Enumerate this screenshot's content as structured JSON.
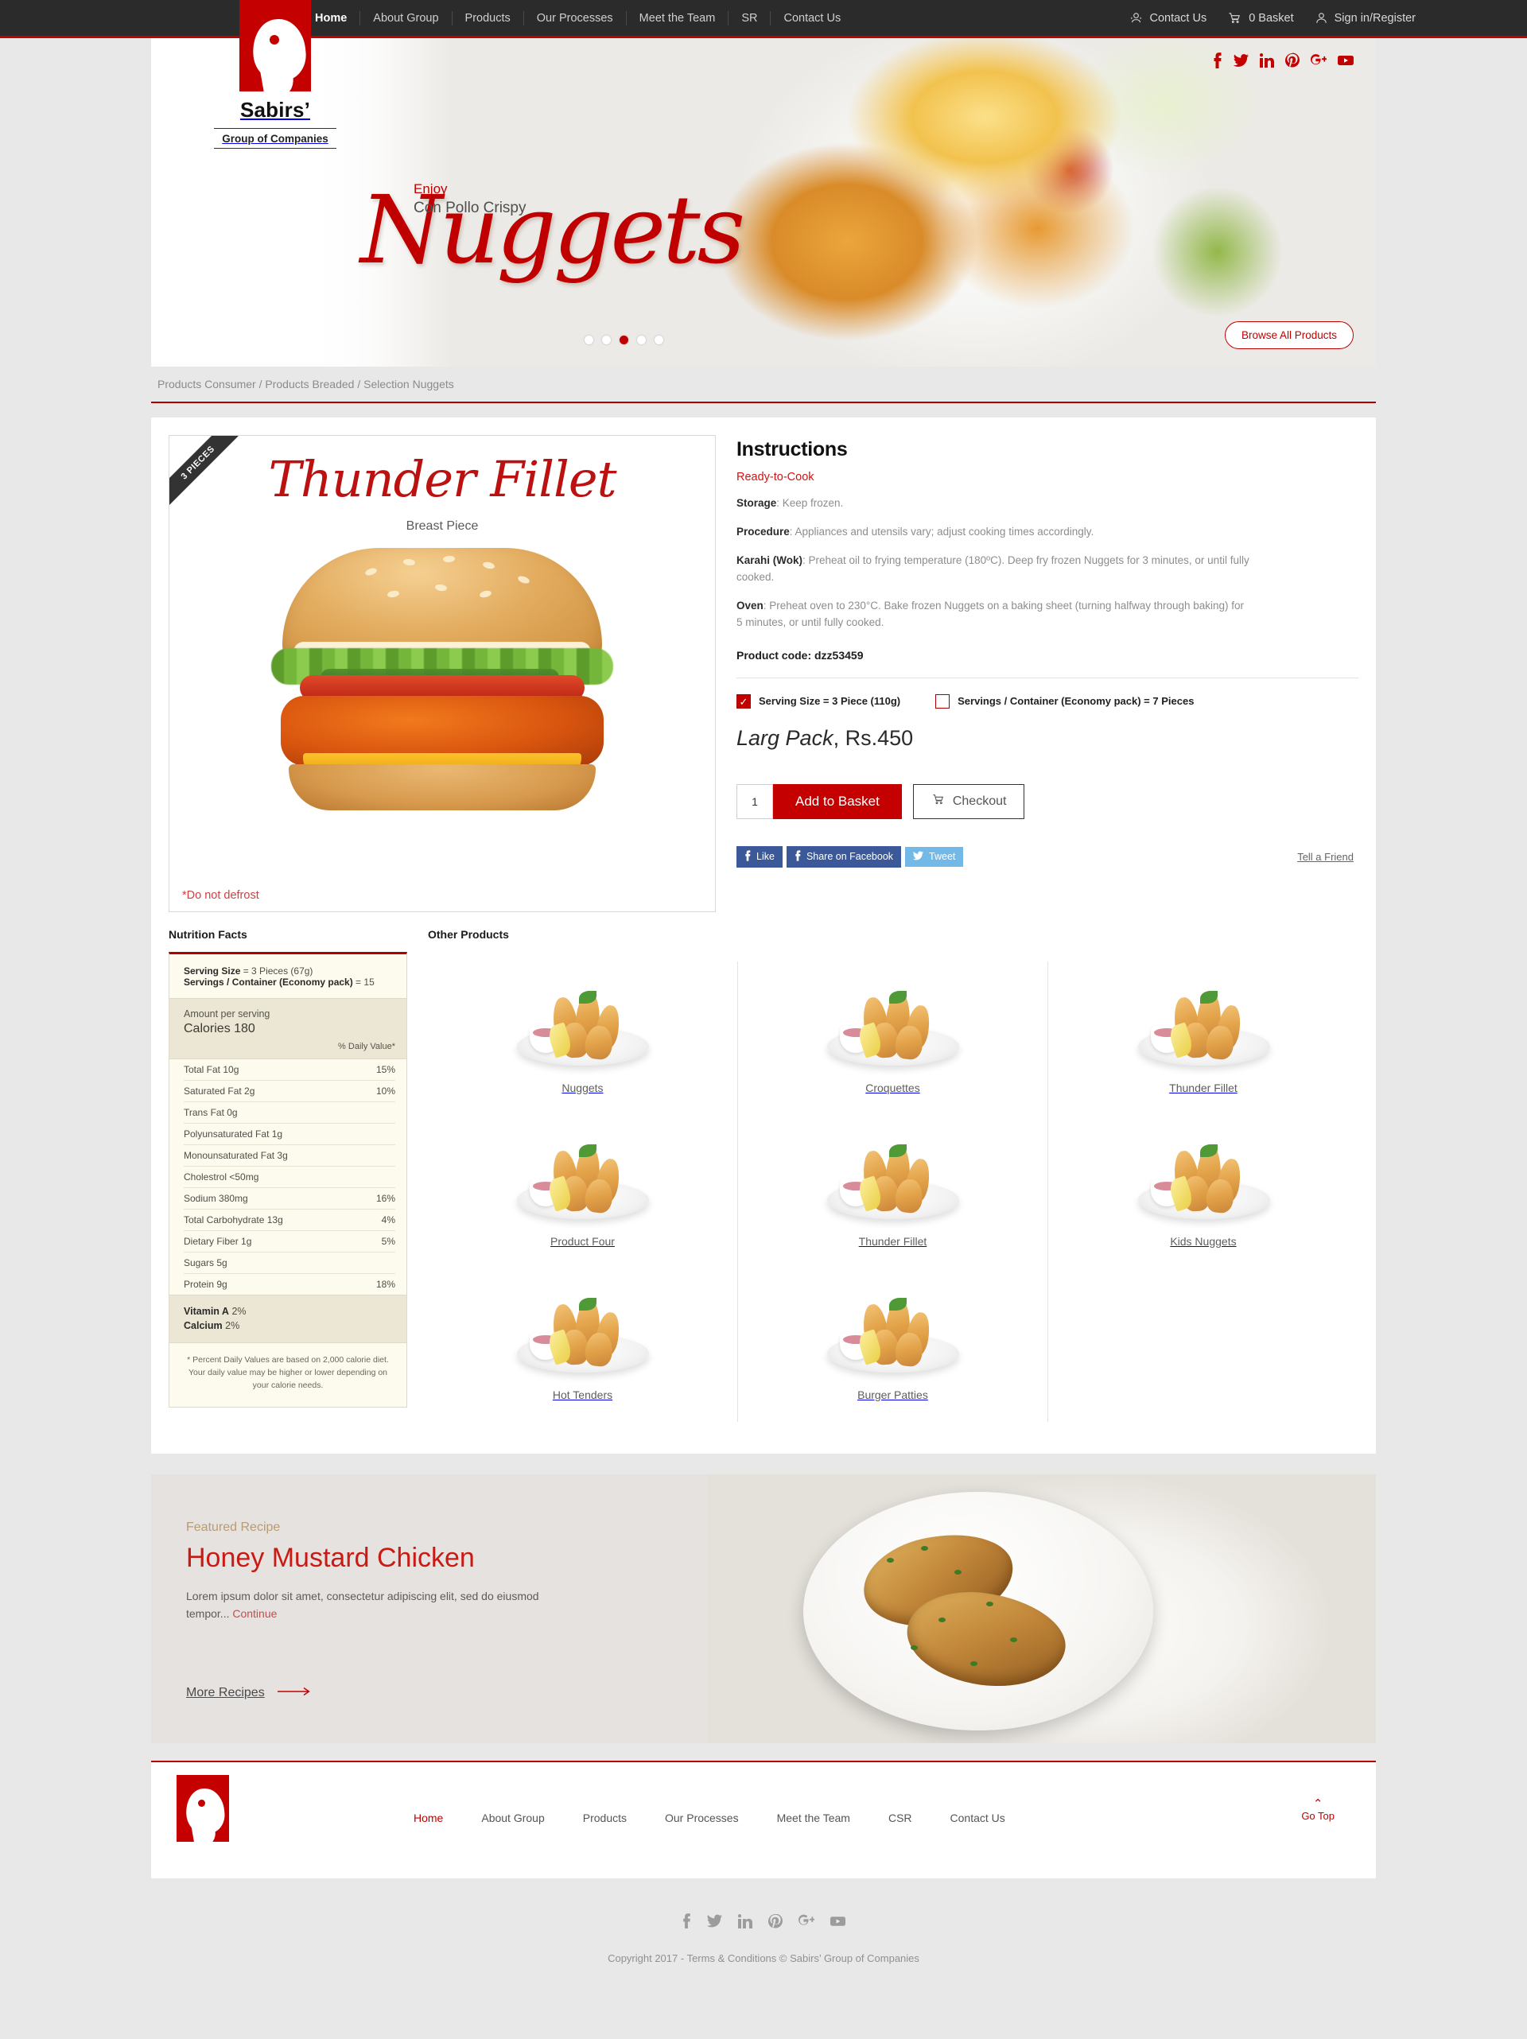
{
  "topbar": {
    "nav": [
      {
        "label": "Home",
        "active": true
      },
      {
        "label": "About Group",
        "active": false
      },
      {
        "label": "Products",
        "active": false
      },
      {
        "label": "Our Processes",
        "active": false
      },
      {
        "label": "Meet the Team",
        "active": false
      },
      {
        "label": "SR",
        "active": false
      },
      {
        "label": "Contact Us",
        "active": false
      }
    ],
    "utilities": [
      {
        "label": "Contact Us",
        "icon": "headset-icon"
      },
      {
        "label": "0 Basket",
        "icon": "cart-icon"
      },
      {
        "label": "Sign in/Register",
        "icon": "user-icon"
      }
    ]
  },
  "logo": {
    "name": "Sabirs’",
    "tagline": "Group of Companies",
    "icon": "chicken-head-logo",
    "brand_color": "#c40000"
  },
  "hero": {
    "enjoy": "Enjoy",
    "subtitle": "Con Pollo Crispy",
    "title": "Nuggets",
    "browse_button": "Browse All Products",
    "dots_total": 5,
    "active_dot": 3,
    "social": [
      "facebook-icon",
      "twitter-icon",
      "linkedin-icon",
      "pinterest-icon",
      "googleplus-icon",
      "youtube-icon"
    ]
  },
  "breadcrumb": "Products Consumer / Products Breaded / Selection Nuggets",
  "product": {
    "ribbon": "3 PIECES",
    "title": "Thunder Fillet",
    "subtitle": "Breast Piece",
    "note": "*Do not defrost"
  },
  "instructions": {
    "heading": "Instructions",
    "ready": "Ready-to-Cook",
    "items": [
      {
        "term": "Storage",
        "text": ": Keep frozen."
      },
      {
        "term": "Procedure",
        "text": ": Appliances and utensils vary; adjust cooking times accordingly."
      },
      {
        "term": "Karahi (Wok)",
        "text": ": Preheat oil to frying temperature (180ºC). Deep fry frozen Nuggets for 3 minutes, or until fully cooked."
      },
      {
        "term": "Oven",
        "text": ": Preheat oven to 230°C. Bake frozen Nuggets on a baking sheet (turning halfway through baking) for 5 minutes, or until fully cooked."
      }
    ],
    "product_code": "Product code: dzz53459"
  },
  "options": {
    "option1": "Serving Size = 3 Piece (110g)",
    "option1_checked": true,
    "option2": "Servings / Container (Economy pack) = 7 Pieces",
    "option2_checked": false,
    "check_glyph": "✓"
  },
  "price": {
    "pack": "Larg Pack",
    "amount": ", Rs.450"
  },
  "buy": {
    "quantity": "1",
    "add_to_basket": "Add to Basket",
    "checkout": "Checkout",
    "cart_icon": "cart-icon"
  },
  "share": {
    "like": "Like",
    "share_facebook": "Share on Facebook",
    "tweet": "Tweet",
    "tell_a_friend": "Tell a Friend"
  },
  "nutrition": {
    "heading": "Nutrition Facts",
    "serving_size": "Serving Size",
    "serving_size_value": " = 3 Pieces (67g)",
    "servings_container": "Servings / Container (Economy pack)",
    "servings_container_value": " = 15",
    "amount_per_serving": "Amount per serving",
    "calories": "Calories 180",
    "daily_value_header": "% Daily Value*",
    "rows": [
      {
        "name": "Total Fat 10g",
        "dv": "15%"
      },
      {
        "name": "Saturated Fat 2g",
        "dv": "10%"
      },
      {
        "name": "Trans Fat 0g",
        "dv": ""
      },
      {
        "name": "Polyunsaturated Fat 1g",
        "dv": ""
      },
      {
        "name": "Monounsaturated Fat 3g",
        "dv": ""
      },
      {
        "name": "Cholestrol <50mg",
        "dv": ""
      },
      {
        "name": "Sodium 380mg",
        "dv": "16%"
      },
      {
        "name": "Total Carbohydrate 13g",
        "dv": "4%"
      },
      {
        "name": "Dietary Fiber 1g",
        "dv": "5%"
      },
      {
        "name": "Sugars 5g",
        "dv": ""
      },
      {
        "name": "Protein 9g",
        "dv": "18%"
      }
    ],
    "vitamin_a": "Vitamin A",
    "vitamin_a_value": " 2%",
    "calcium": "Calcium",
    "calcium_value": " 2%",
    "footnote": "* Percent Daily Values are based on 2,000 calorie diet. Your daily value may be higher or lower depending on your calorie needs."
  },
  "other_products": {
    "heading": "Other Products",
    "items": [
      {
        "label": "Nuggets"
      },
      {
        "label": "Croquettes"
      },
      {
        "label": "Thunder Fillet"
      },
      {
        "label": "Product Four"
      },
      {
        "label": "Thunder Fillet"
      },
      {
        "label": "Kids Nuggets"
      },
      {
        "label": "Hot Tenders"
      },
      {
        "label": "Burger Patties"
      }
    ]
  },
  "recipe": {
    "kicker": "Featured Recipe",
    "title": "Honey Mustard Chicken",
    "body": "Lorem ipsum dolor sit amet, consectetur adipiscing elit, sed do eiusmod tempor... ",
    "continue": "Continue",
    "more": "More Recipes",
    "arrow": "⟶"
  },
  "footer": {
    "nav": [
      {
        "label": "Home",
        "active": true
      },
      {
        "label": "About Group",
        "active": false
      },
      {
        "label": "Products",
        "active": false
      },
      {
        "label": "Our Processes",
        "active": false
      },
      {
        "label": "Meet the Team",
        "active": false
      },
      {
        "label": "CSR",
        "active": false
      },
      {
        "label": "Contact Us",
        "active": false
      }
    ],
    "go_top": "Go Top",
    "go_top_chevron": "⌃",
    "social": [
      "facebook-icon",
      "twitter-icon",
      "linkedin-icon",
      "pinterest-icon",
      "googleplus-icon",
      "youtube-icon"
    ],
    "copyright": "Copyright 2017 - Terms & Conditions  © Sabirs’ Group of Companies"
  }
}
